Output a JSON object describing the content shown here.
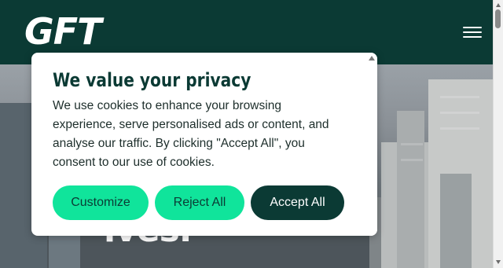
{
  "header": {
    "logo_text": "GFT",
    "menu_icon": "hamburger-menu-icon"
  },
  "hero": {
    "visible_text": "ives."
  },
  "cookie_banner": {
    "title": "We value your privacy",
    "body": "We use cookies to enhance your browsing experience, serve personalised ads or content, and analyse our traffic. By clicking \"Accept All\", you consent to our use of cookies.",
    "buttons": {
      "customize": "Customize",
      "reject": "Reject All",
      "accept": "Accept All"
    }
  },
  "colors": {
    "brand_dark": "#0b3a34",
    "accent_green": "#10e49b",
    "text_dark": "#1d2e2b"
  }
}
